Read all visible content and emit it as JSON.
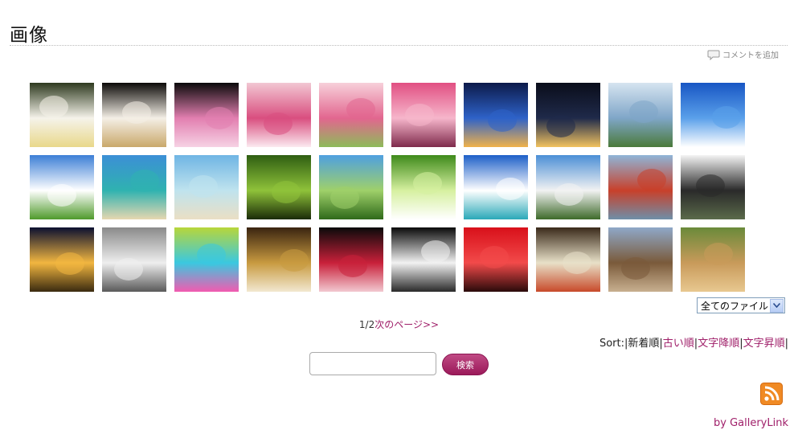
{
  "page": {
    "title": "画像"
  },
  "comment": {
    "label": "コメントを追加",
    "icon": "speech-bubble-icon"
  },
  "gallery": {
    "thumbnails": [
      {
        "name": "plumeria-flowers",
        "colors": [
          "#2e3a1f",
          "#f5f3ea",
          "#e9d88a"
        ]
      },
      {
        "name": "white-plum-blossom",
        "colors": [
          "#0c0a08",
          "#f4efe6",
          "#c9a86a"
        ]
      },
      {
        "name": "pink-lotus",
        "colors": [
          "#0a0a0a",
          "#e27fb0",
          "#f6d2e4"
        ]
      },
      {
        "name": "pink-bouquet",
        "colors": [
          "#f2c7d3",
          "#d94e7f",
          "#fbeaf0"
        ]
      },
      {
        "name": "pink-roses",
        "colors": [
          "#f7d0da",
          "#e2668f",
          "#8dbb5a"
        ]
      },
      {
        "name": "pink-blossoms-closeup",
        "colors": [
          "#e14f82",
          "#f6b6cb",
          "#7e2a4b"
        ]
      },
      {
        "name": "tropical-sunset",
        "colors": [
          "#0c1a4a",
          "#2e62c8",
          "#f0b24a"
        ]
      },
      {
        "name": "city-night-view",
        "colors": [
          "#0a0d1a",
          "#1f2a4a",
          "#f2c360"
        ]
      },
      {
        "name": "clouds-over-hill",
        "colors": [
          "#d6e4f0",
          "#7fa6c8",
          "#4b7a3a"
        ]
      },
      {
        "name": "blue-sky-clouds",
        "colors": [
          "#1856c4",
          "#5aa0ea",
          "#ffffff"
        ]
      },
      {
        "name": "green-field-sky",
        "colors": [
          "#3c7fd6",
          "#ffffff",
          "#4f9a2b"
        ]
      },
      {
        "name": "tropical-beach",
        "colors": [
          "#3c8fd6",
          "#2fb2b0",
          "#e6d7b0"
        ]
      },
      {
        "name": "white-sand-beach",
        "colors": [
          "#6fb5e4",
          "#bfe3ee",
          "#eadfc4"
        ]
      },
      {
        "name": "green-forest",
        "colors": [
          "#2f5e12",
          "#8fc23a",
          "#1a2c08"
        ]
      },
      {
        "name": "single-tree-field",
        "colors": [
          "#4fa0e0",
          "#9fd06a",
          "#2f6a1a"
        ]
      },
      {
        "name": "sunlight-leaves",
        "colors": [
          "#3e8a1a",
          "#d6f0a0",
          "#ffffff"
        ]
      },
      {
        "name": "blue-sky-sea",
        "colors": [
          "#1d5fc8",
          "#ffffff",
          "#2aa8b8"
        ]
      },
      {
        "name": "clock-tower",
        "colors": [
          "#4b8fd6",
          "#f2f2f2",
          "#3e6a2a"
        ]
      },
      {
        "name": "torii-gate-sea",
        "colors": [
          "#8fb5d8",
          "#c8402a",
          "#6e8fa8"
        ]
      },
      {
        "name": "white-castle",
        "colors": [
          "#f4f4f4",
          "#2a2a2a",
          "#5a6a4a"
        ]
      },
      {
        "name": "temple-night",
        "colors": [
          "#0b1030",
          "#f2b640",
          "#3a2a10"
        ]
      },
      {
        "name": "milk-crown",
        "colors": [
          "#8a8a8a",
          "#eeeeee",
          "#5a5a5a"
        ]
      },
      {
        "name": "bokeh-bubbles",
        "colors": [
          "#b8d63a",
          "#3ac8e0",
          "#f25ab0"
        ]
      },
      {
        "name": "gold-pocket-watch",
        "colors": [
          "#3a2410",
          "#c89a40",
          "#f2e8d0"
        ]
      },
      {
        "name": "red-gemstone",
        "colors": [
          "#0a0a0a",
          "#c8203a",
          "#f2c8d0"
        ]
      },
      {
        "name": "piano-keys",
        "colors": [
          "#0a0a0a",
          "#f2f2f2",
          "#2a2a2a"
        ]
      },
      {
        "name": "red-umbrella",
        "colors": [
          "#d8101a",
          "#f24a4a",
          "#2a0a0a"
        ]
      },
      {
        "name": "sashimi-platter",
        "colors": [
          "#3a2a1a",
          "#e8e0c8",
          "#c84a2a"
        ]
      },
      {
        "name": "deer",
        "colors": [
          "#8fa8c8",
          "#7a5a3a",
          "#c8b090"
        ]
      },
      {
        "name": "lion-resting",
        "colors": [
          "#6a8a3a",
          "#c89a5a",
          "#e8c890"
        ]
      }
    ]
  },
  "filter": {
    "selected": "全てのファイル",
    "arrow_icon": "chevron-down-icon"
  },
  "pager": {
    "current": "1/2",
    "next_label": "次のページ>>"
  },
  "sort": {
    "label": "Sort:",
    "active": "新着順",
    "options": [
      "古い順",
      "文字降順",
      "文字昇順"
    ]
  },
  "search": {
    "value": "",
    "button_label": "検索"
  },
  "footer": {
    "rss_icon": "rss-feed-icon",
    "credit": "by GalleryLink"
  }
}
